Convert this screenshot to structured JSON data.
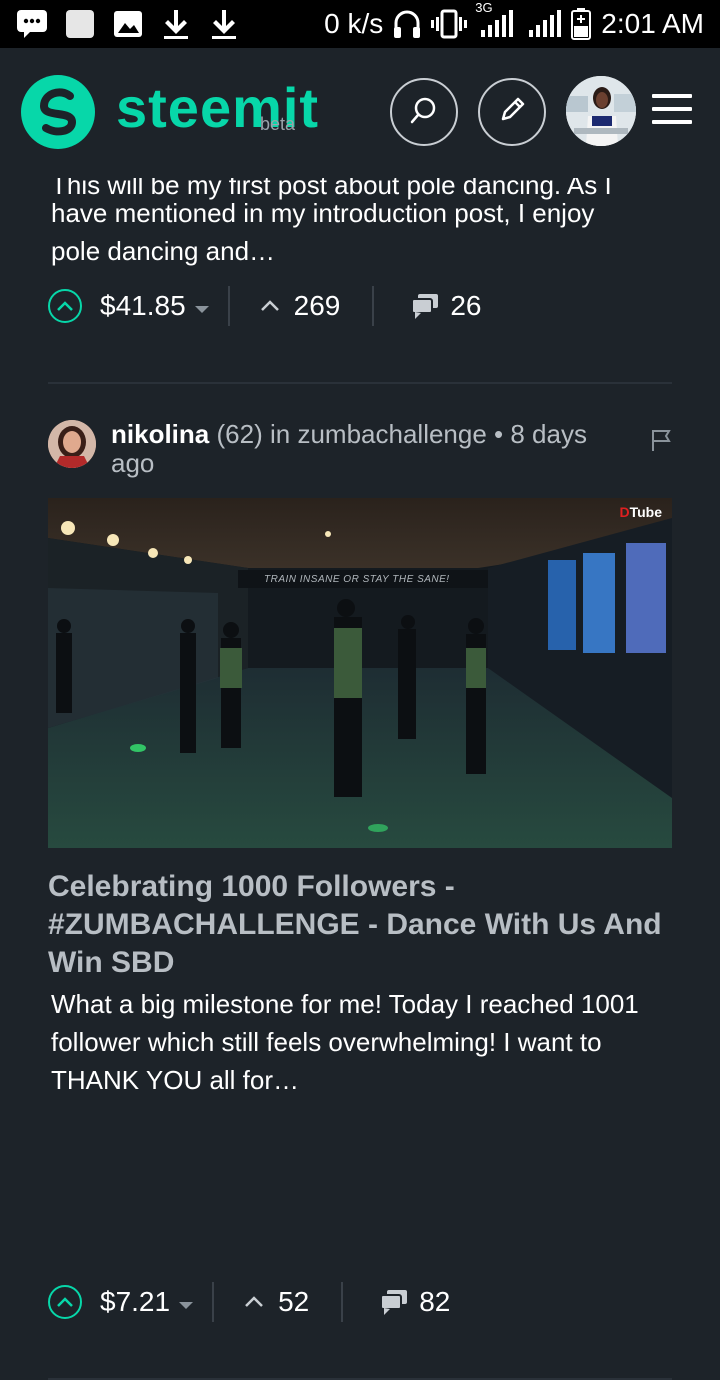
{
  "status_bar": {
    "speed": "0 k/s",
    "network": "3G",
    "time": "2:01 AM",
    "left_icons": [
      "chat-icon",
      "square-icon",
      "image-icon",
      "download-icon",
      "download-icon"
    ],
    "right_icons": [
      "headphones-icon",
      "vibrate-icon",
      "signal-icon",
      "signal-icon",
      "battery-icon"
    ]
  },
  "header": {
    "logo_text": "steemit",
    "logo_badge": "beta",
    "search_icon": "search-icon",
    "edit_icon": "pencil-icon",
    "menu_icon": "hamburger-icon"
  },
  "posts": [
    {
      "excerpt_cut": "This will be my first post about pole dancing. As I",
      "excerpt_line2": "have mentioned in my introduction post, I enjoy",
      "excerpt_line3": "pole dancing and…",
      "payout": "$41.85",
      "votes": "269",
      "comments": "26"
    },
    {
      "author": "nikolina",
      "reputation": "(62)",
      "community_prefix": "in",
      "community": "zumbachallenge",
      "age": "• 8 days ago",
      "thumbnail_banner": "TRAIN INSANE OR STAY THE SANE!",
      "thumbnail_badge_mark": "D",
      "thumbnail_badge": "Tube",
      "title": "Celebrating 1000 Followers - #ZUMBACHALLENGE - Dance With Us And Win SBD",
      "excerpt": "What a big milestone for me! Today I reached 1001 follower which still feels overwhelming! I want to THANK YOU all for…",
      "payout": "$7.21",
      "votes": "52",
      "comments": "82"
    }
  ],
  "colors": {
    "accent": "#07d7a9",
    "background": "#1d2329",
    "muted_text": "#b8bec4",
    "dtube_red": "#e02020"
  }
}
